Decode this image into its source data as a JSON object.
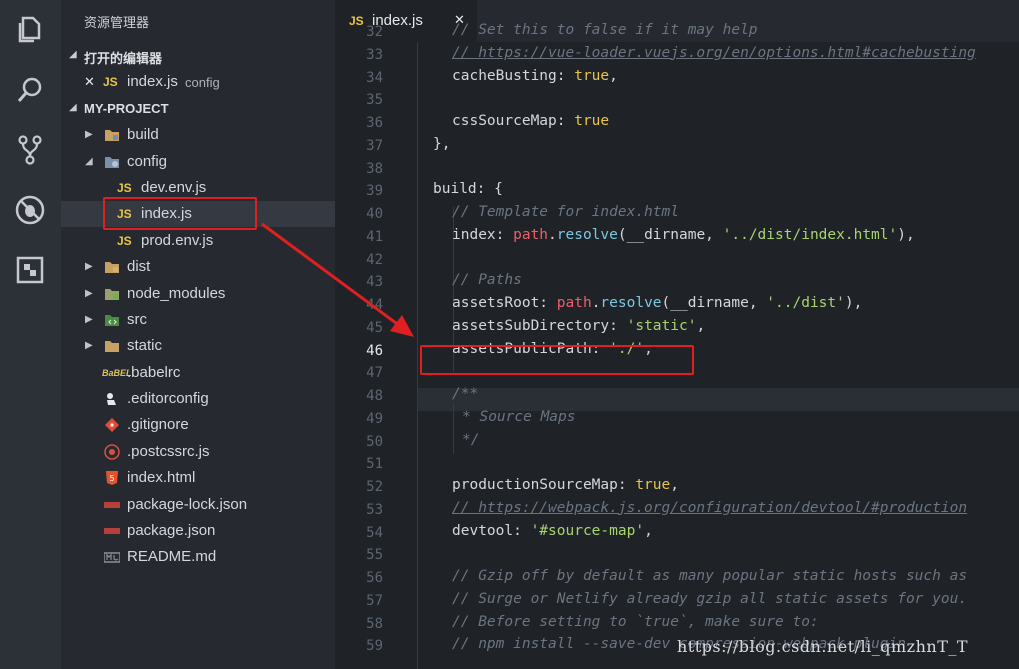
{
  "explorer": {
    "title": "资源管理器",
    "open_editors": {
      "label": "打开的编辑器",
      "items": [
        {
          "close": "✕",
          "name": "index.js",
          "folder": "config"
        }
      ]
    },
    "project": {
      "label": "MY-PROJECT",
      "tree": [
        {
          "name": "build"
        },
        {
          "name": "config"
        },
        {
          "name": "dev.env.js"
        },
        {
          "name": "index.js"
        },
        {
          "name": "prod.env.js"
        },
        {
          "name": "dist"
        },
        {
          "name": "node_modules"
        },
        {
          "name": "src"
        },
        {
          "name": "static"
        },
        {
          "name": ".babelrc"
        },
        {
          "name": ".editorconfig"
        },
        {
          "name": ".gitignore"
        },
        {
          "name": ".postcssrc.js"
        },
        {
          "name": "index.html"
        },
        {
          "name": "package-lock.json"
        },
        {
          "name": "package.json"
        },
        {
          "name": "README.md"
        }
      ]
    }
  },
  "file_badge": "JS",
  "editor": {
    "tab": {
      "label": "index.js",
      "close": "✕"
    },
    "current_line": "46",
    "lines": [
      {
        "n": "32",
        "t": "// Set this to false if it may help"
      },
      {
        "n": "33",
        "t": "// https://vue-loader.vuejs.org/en/options.html#cachebusting"
      },
      {
        "n": "34",
        "t": "cacheBusting: true,"
      },
      {
        "n": "35",
        "t": ""
      },
      {
        "n": "36",
        "t": "cssSourceMap: true"
      },
      {
        "n": "37",
        "t": "},"
      },
      {
        "n": "38",
        "t": ""
      },
      {
        "n": "39",
        "t": "build: {"
      },
      {
        "n": "40",
        "t": "// Template for index.html"
      },
      {
        "n": "41",
        "t": "index: path.resolve(__dirname, '../dist/index.html'),"
      },
      {
        "n": "42",
        "t": ""
      },
      {
        "n": "43",
        "t": "// Paths"
      },
      {
        "n": "44",
        "t": "assetsRoot: path.resolve(__dirname, '../dist'),"
      },
      {
        "n": "45",
        "t": "assetsSubDirectory: 'static',"
      },
      {
        "n": "46",
        "t": "assetsPublicPath: './',"
      },
      {
        "n": "47",
        "t": ""
      },
      {
        "n": "48",
        "t": "/**"
      },
      {
        "n": "49",
        "t": "* Source Maps"
      },
      {
        "n": "50",
        "t": "*/"
      },
      {
        "n": "51",
        "t": ""
      },
      {
        "n": "52",
        "t": "productionSourceMap: true,"
      },
      {
        "n": "53",
        "t": "// https://webpack.js.org/configuration/devtool/#production"
      },
      {
        "n": "54",
        "t": "devtool: '#source-map',"
      },
      {
        "n": "55",
        "t": ""
      },
      {
        "n": "56",
        "t": "// Gzip off by default as many popular static hosts such as"
      },
      {
        "n": "57",
        "t": "// Surge or Netlify already gzip all static assets for you."
      },
      {
        "n": "58",
        "t": "// Before setting to `true`, make sure to:"
      },
      {
        "n": "59",
        "t": "// npm install --save-dev compression-webpack-plugin"
      }
    ]
  },
  "watermark": "https://blog.csdn.net/li_qmzhnT_T",
  "colors": {
    "highlight": "#e02020",
    "js_badge": "#e8c547",
    "string": "#a8d46f",
    "keyword_true": "#e8c547"
  }
}
